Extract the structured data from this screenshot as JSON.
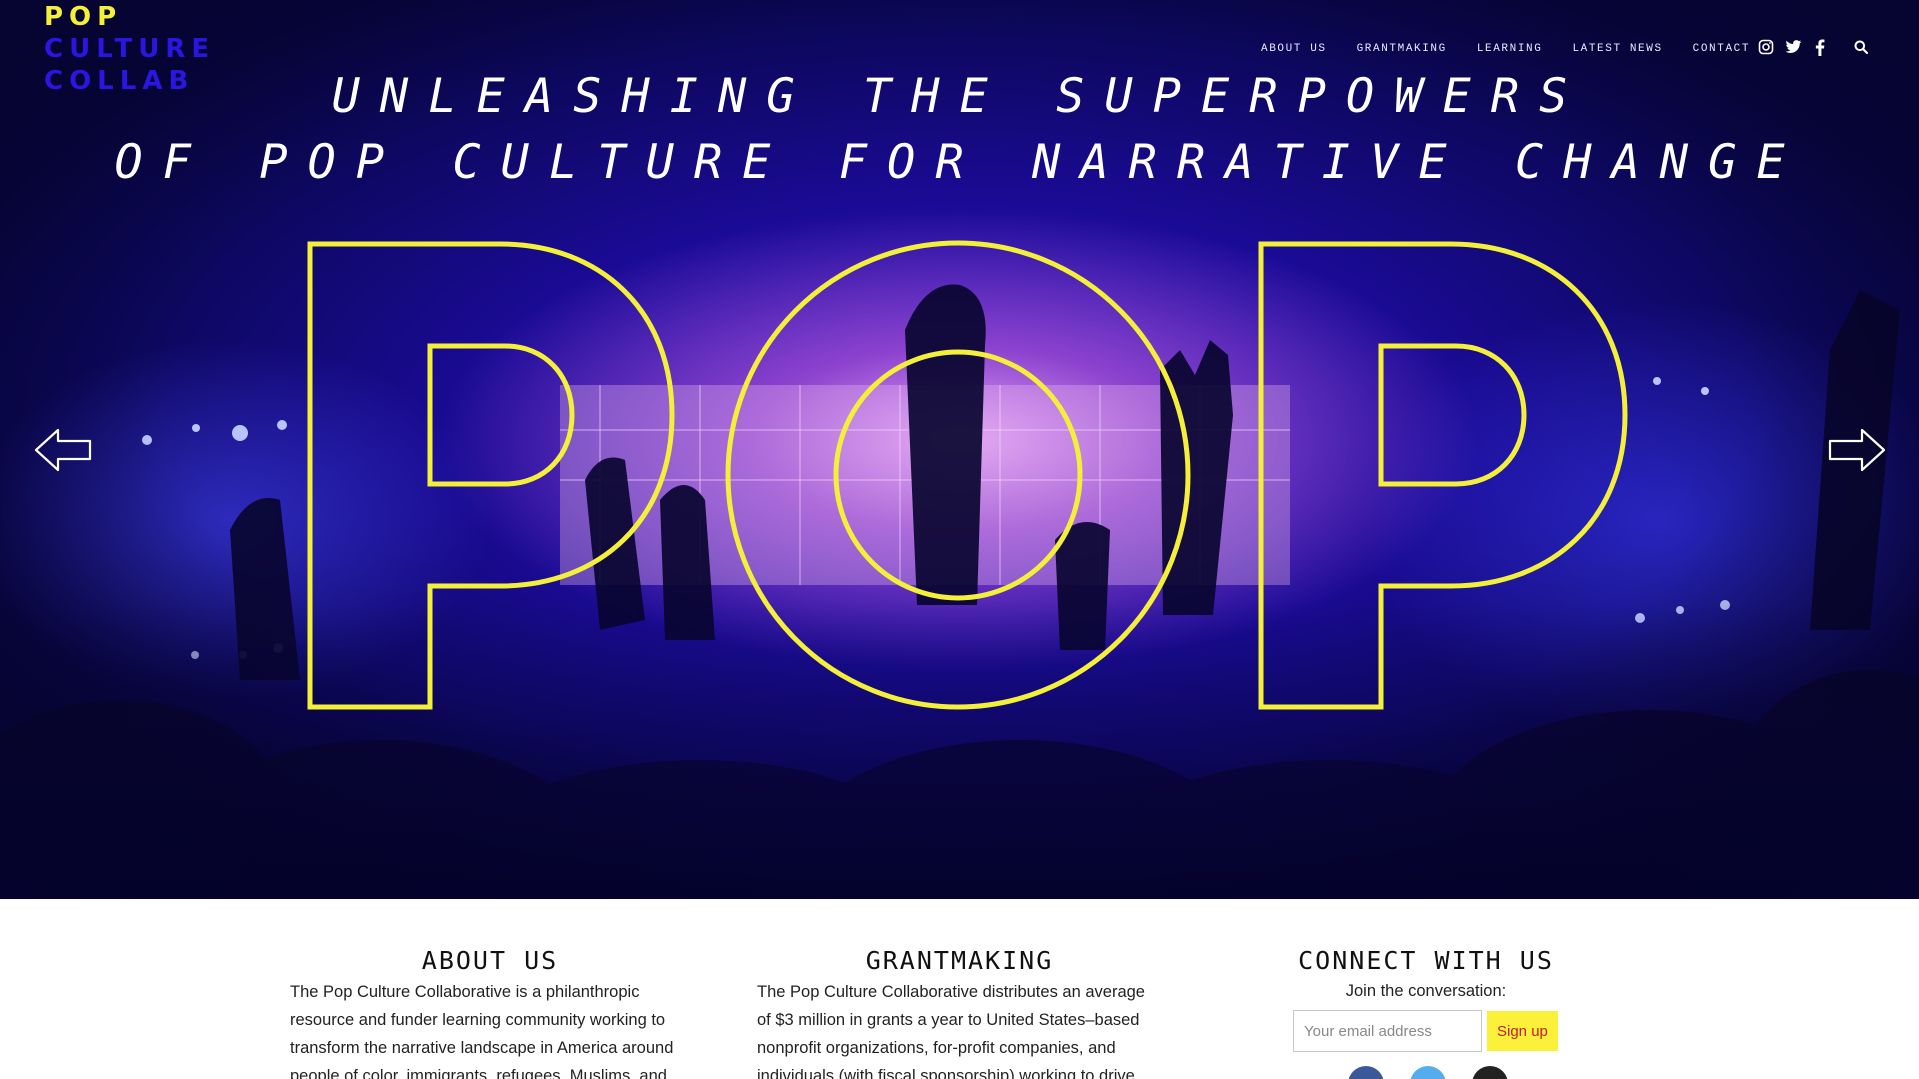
{
  "site": {
    "logo": {
      "line1": "POP",
      "line2": "CULTURE",
      "line3": "COLLAB",
      "yellow": "#f4f03a",
      "blue": "#2a16e0"
    }
  },
  "nav": {
    "items": [
      "ABOUT US",
      "GRANTMAKING",
      "LEARNING",
      "LATEST NEWS",
      "CONTACT"
    ],
    "social_icons": [
      "instagram-icon",
      "twitter-icon",
      "facebook-icon"
    ],
    "search_icon": "search-icon"
  },
  "hero": {
    "headline_line1": "UNLEASHING THE SUPERPOWERS",
    "headline_line2": "OF POP CULTURE FOR NARRATIVE CHANGE",
    "big_word": "POP",
    "outline_color": "#f4f03a",
    "prev_icon": "arrow-left-icon",
    "next_icon": "arrow-right-icon"
  },
  "about": {
    "title": "ABOUT US",
    "text": "The Pop Culture Collaborative is a philanthropic resource and funder learning community working to transform the narrative landscape in America around people of color, immigrants, refugees, Muslims, and"
  },
  "grantmaking": {
    "title": "GRANTMAKING",
    "text": "The Pop Culture Collaborative distributes an average of $3 million in grants a year to United States–based nonprofit organizations, for-profit companies, and individuals (with fiscal sponsorship) working to drive"
  },
  "connect": {
    "title": "CONNECT WITH US",
    "subtitle": "Join the conversation:",
    "email_placeholder": "Your email address",
    "signup_label": "Sign up",
    "social_icons": [
      "facebook-icon",
      "twitter-icon",
      "instagram-icon"
    ],
    "colors": {
      "facebook": "#3b5998",
      "twitter": "#55acee",
      "instagram": "#222222",
      "button_bg": "#fbf13a",
      "button_text": "#c11e2a"
    }
  }
}
